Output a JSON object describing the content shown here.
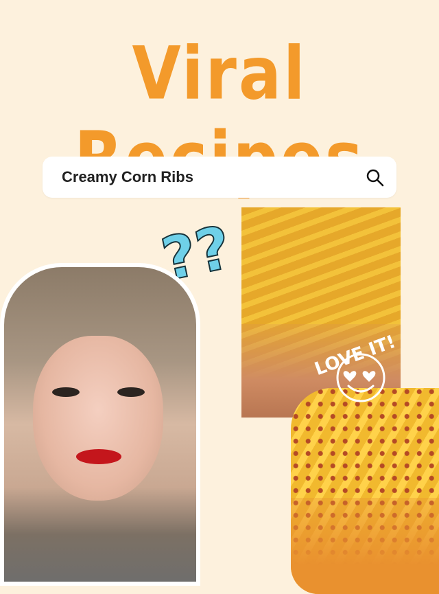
{
  "header": {
    "title": "Viral Recipes"
  },
  "search": {
    "query": "Creamy Corn Ribs",
    "icon": "search-icon"
  },
  "decorations": {
    "question_marks": "??",
    "sticker_text": "LOVE IT!"
  },
  "colors": {
    "background": "#fdf1dd",
    "title": "#f39a2b",
    "question_marks": "#6fd0e8"
  }
}
